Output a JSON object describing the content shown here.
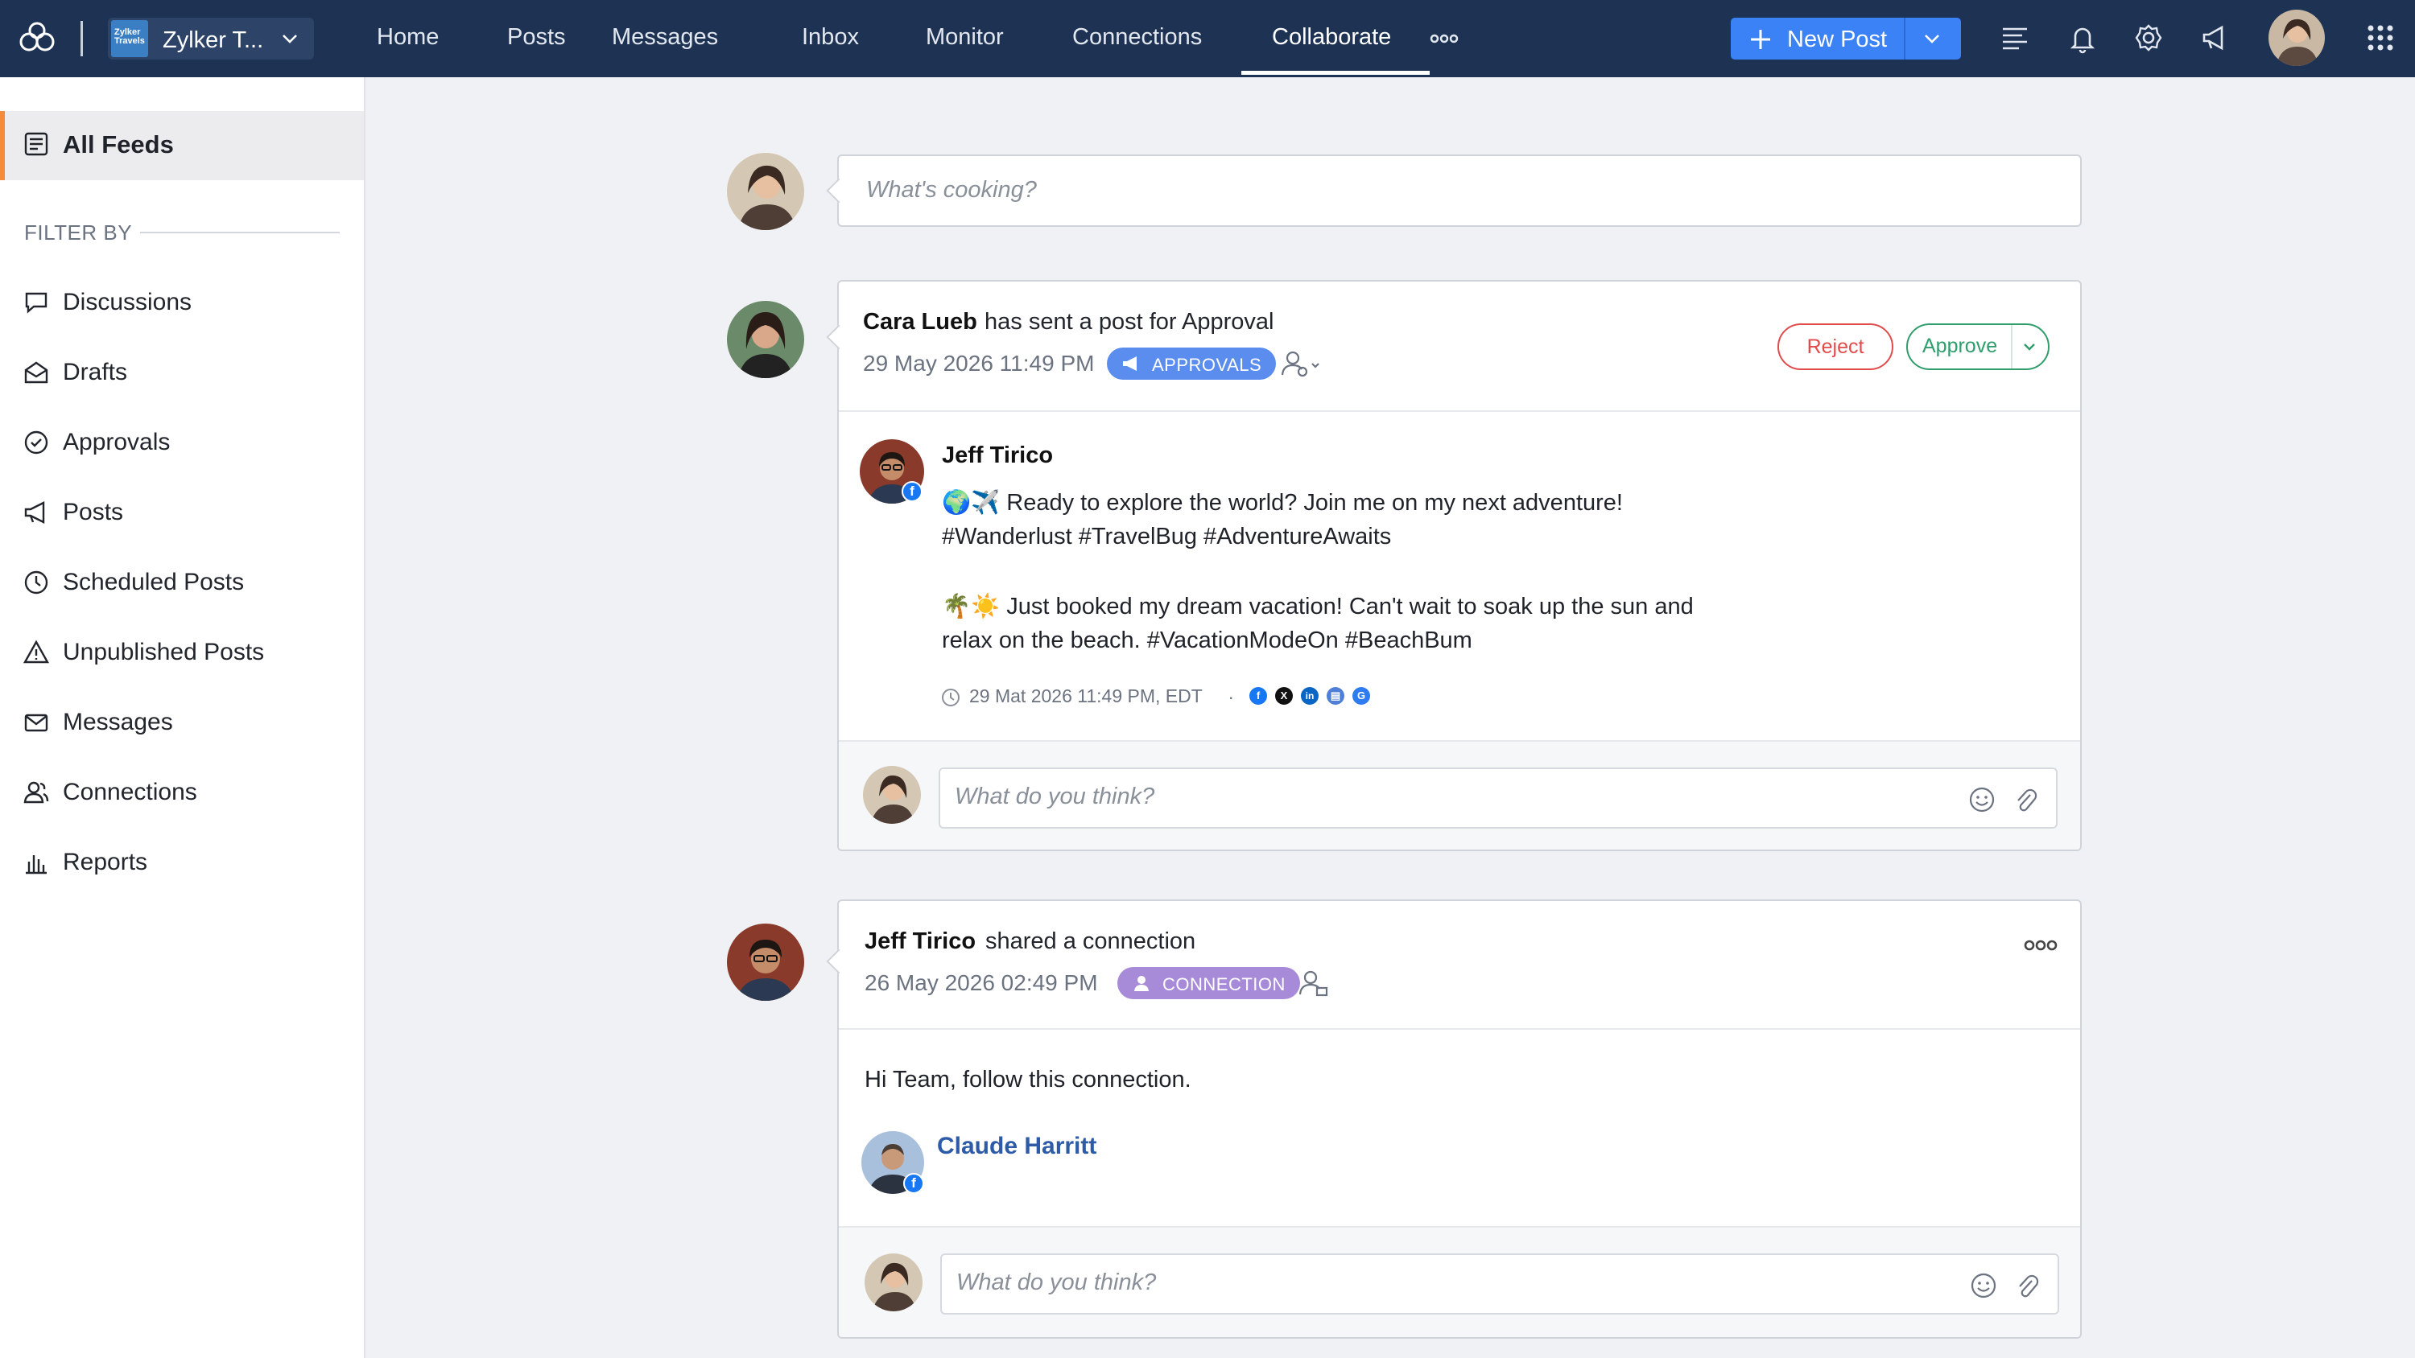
{
  "topbar": {
    "brand_name": "Zylker T...",
    "brand_logo_text": "Zylker Travels",
    "nav": [
      "Home",
      "Posts",
      "Messages",
      "Inbox",
      "Monitor",
      "Connections",
      "Collaborate"
    ],
    "active_nav": "Collaborate",
    "new_post_label": "New Post"
  },
  "sidebar": {
    "all_feeds": "All Feeds",
    "filter_by": "FILTER BY",
    "items": [
      {
        "label": "Discussions",
        "icon": "chat-bubble-icon"
      },
      {
        "label": "Drafts",
        "icon": "drafts-icon"
      },
      {
        "label": "Approvals",
        "icon": "check-circle-icon"
      },
      {
        "label": "Posts",
        "icon": "megaphone-icon"
      },
      {
        "label": "Scheduled Posts",
        "icon": "clock-icon"
      },
      {
        "label": "Unpublished Posts",
        "icon": "warning-icon"
      },
      {
        "label": "Messages",
        "icon": "envelope-icon"
      },
      {
        "label": "Connections",
        "icon": "people-icon"
      },
      {
        "label": "Reports",
        "icon": "bar-chart-icon"
      }
    ]
  },
  "compose": {
    "placeholder": "What's cooking?"
  },
  "feed": [
    {
      "name": "Cara Lueb",
      "action": "has sent a post for Approval",
      "time": "29 May 2026 11:49 PM",
      "tag": "APPROVALS",
      "reject_label": "Reject",
      "approve_label": "Approve",
      "post": {
        "author": "Jeff Tirico",
        "line1": "🌍✈️ Ready to explore the world? Join me on my next adventure!",
        "line2": "#Wanderlust #TravelBug #AdventureAwaits",
        "line3": "🌴☀️ Just booked my dream vacation! Can't wait to soak up the sun and",
        "line4": "relax on the beach. #VacationModeOn #BeachBum",
        "scheduled": "29 Mat 2026 11:49 PM, EDT",
        "networks": [
          "facebook",
          "x",
          "linkedin",
          "google-business",
          "google"
        ]
      },
      "comment_placeholder": "What do you think?"
    },
    {
      "name": "Jeff Tirico",
      "action": "shared a connection",
      "time": "26 May 2026 02:49 PM",
      "tag": "CONNECTION",
      "message": "Hi Team, follow this connection.",
      "connection_name": "Claude Harritt",
      "comment_placeholder": "What do you think?"
    }
  ],
  "colors": {
    "topbar": "#1e3353",
    "accent_blue": "#3b82f6",
    "sidebar_active_border": "#f28b3c",
    "approvals_tag": "#5b8def",
    "connection_tag": "#a78bd8",
    "reject": "#e24b4b",
    "approve": "#2f9e6c"
  }
}
